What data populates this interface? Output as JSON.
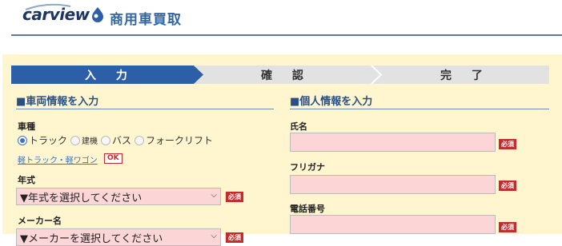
{
  "header": {
    "logo_text": "carview",
    "site_title": "商用車買取"
  },
  "steps": [
    {
      "label": "入 力",
      "state": "active"
    },
    {
      "label": "確 認",
      "state": "inactive"
    },
    {
      "label": "完 了",
      "state": "inactive"
    }
  ],
  "vehicle": {
    "section_title": "■車両情報を入力",
    "type_label": "車種",
    "types": [
      {
        "label": "トラック",
        "checked": true
      },
      {
        "label": "建機",
        "checked": false
      },
      {
        "label": "バス",
        "checked": false
      },
      {
        "label": "フォークリフト",
        "checked": false
      }
    ],
    "kei_link": "軽トラック・軽ワゴン",
    "kei_badge": "OK",
    "year_label": "年式",
    "year_select": "▼年式を選択してください",
    "maker_label": "メーカー名",
    "maker_select": "▼メーカーを選択してください"
  },
  "personal": {
    "section_title": "■個人情報を入力",
    "name_label": "氏名",
    "kana_label": "フリガナ",
    "phone_label": "電話番号"
  },
  "required_label": "必須",
  "colors": {
    "accent": "#2d5fa8",
    "required": "#c62a2a",
    "panel": "#fff5cf",
    "input_bg": "#fcd6d6"
  }
}
